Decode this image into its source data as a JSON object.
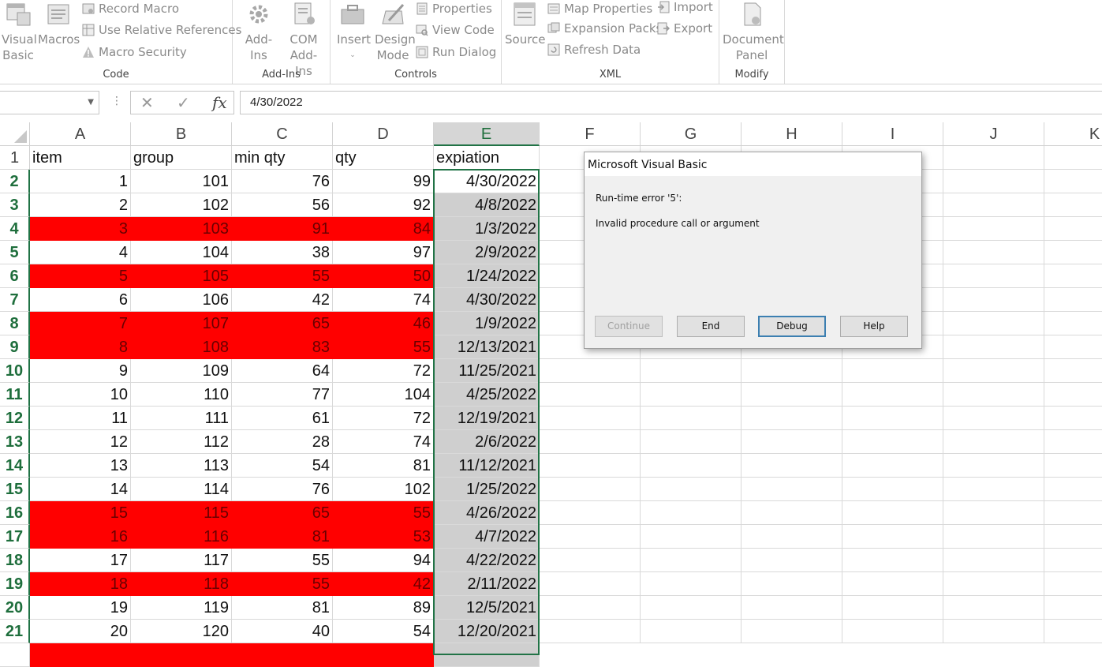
{
  "ribbon": {
    "code": {
      "label": "Code",
      "visual_basic": [
        "Visual",
        "Basic"
      ],
      "macros": "Macros",
      "record_macro": "Record Macro",
      "relative_refs": "Use Relative References",
      "macro_security": "Macro Security"
    },
    "addins": {
      "label": "Add-Ins",
      "addins_btn": "Add-Ins",
      "com_addins": [
        "COM",
        "Add-Ins"
      ]
    },
    "controls": {
      "label": "Controls",
      "insert": "Insert",
      "design_mode": [
        "Design",
        "Mode"
      ],
      "properties": "Properties",
      "view_code": "View Code",
      "run_dialog": "Run Dialog"
    },
    "xml": {
      "label": "XML",
      "source": "Source",
      "map_properties": "Map Properties",
      "expansion_packs": "Expansion Packs",
      "refresh_data": "Refresh Data",
      "import": "Import",
      "export": "Export"
    },
    "modify": {
      "label": "Modify",
      "document_panel": [
        "Document",
        "Panel"
      ]
    }
  },
  "formula_bar": {
    "name_box": "",
    "value": "4/30/2022",
    "fx": "fx"
  },
  "sheet": {
    "columns": [
      "A",
      "B",
      "C",
      "D",
      "E",
      "F",
      "G",
      "H",
      "I",
      "J",
      "K"
    ],
    "selected_column": "E",
    "headers": [
      "item",
      "group",
      "min qty",
      "qty",
      "expiation"
    ],
    "rows": [
      {
        "n": "2",
        "item": "1",
        "group": "101",
        "min": "76",
        "qty": "99",
        "exp": "4/30/2022",
        "red": false
      },
      {
        "n": "3",
        "item": "2",
        "group": "102",
        "min": "56",
        "qty": "92",
        "exp": "4/8/2022",
        "red": false
      },
      {
        "n": "4",
        "item": "3",
        "group": "103",
        "min": "91",
        "qty": "84",
        "exp": "1/3/2022",
        "red": true
      },
      {
        "n": "5",
        "item": "4",
        "group": "104",
        "min": "38",
        "qty": "97",
        "exp": "2/9/2022",
        "red": false
      },
      {
        "n": "6",
        "item": "5",
        "group": "105",
        "min": "55",
        "qty": "50",
        "exp": "1/24/2022",
        "red": true
      },
      {
        "n": "7",
        "item": "6",
        "group": "106",
        "min": "42",
        "qty": "74",
        "exp": "4/30/2022",
        "red": false
      },
      {
        "n": "8",
        "item": "7",
        "group": "107",
        "min": "65",
        "qty": "46",
        "exp": "1/9/2022",
        "red": true
      },
      {
        "n": "9",
        "item": "8",
        "group": "108",
        "min": "83",
        "qty": "55",
        "exp": "12/13/2021",
        "red": true
      },
      {
        "n": "10",
        "item": "9",
        "group": "109",
        "min": "64",
        "qty": "72",
        "exp": "11/25/2021",
        "red": false
      },
      {
        "n": "11",
        "item": "10",
        "group": "110",
        "min": "77",
        "qty": "104",
        "exp": "4/25/2022",
        "red": false
      },
      {
        "n": "12",
        "item": "11",
        "group": "111",
        "min": "61",
        "qty": "72",
        "exp": "12/19/2021",
        "red": false
      },
      {
        "n": "13",
        "item": "12",
        "group": "112",
        "min": "28",
        "qty": "74",
        "exp": "2/6/2022",
        "red": false
      },
      {
        "n": "14",
        "item": "13",
        "group": "113",
        "min": "54",
        "qty": "81",
        "exp": "11/12/2021",
        "red": false
      },
      {
        "n": "15",
        "item": "14",
        "group": "114",
        "min": "76",
        "qty": "102",
        "exp": "1/25/2022",
        "red": false
      },
      {
        "n": "16",
        "item": "15",
        "group": "115",
        "min": "65",
        "qty": "55",
        "exp": "4/26/2022",
        "red": true
      },
      {
        "n": "17",
        "item": "16",
        "group": "116",
        "min": "81",
        "qty": "53",
        "exp": "4/7/2022",
        "red": true
      },
      {
        "n": "18",
        "item": "17",
        "group": "117",
        "min": "55",
        "qty": "94",
        "exp": "4/22/2022",
        "red": false
      },
      {
        "n": "19",
        "item": "18",
        "group": "118",
        "min": "55",
        "qty": "42",
        "exp": "2/11/2022",
        "red": true
      },
      {
        "n": "20",
        "item": "19",
        "group": "119",
        "min": "81",
        "qty": "89",
        "exp": "12/5/2021",
        "red": false
      },
      {
        "n": "21",
        "item": "20",
        "group": "120",
        "min": "40",
        "qty": "54",
        "exp": "12/20/2021",
        "red": false
      }
    ],
    "header_row_number": "1"
  },
  "dialog": {
    "title": "Microsoft Visual Basic",
    "error": "Run-time error '5':",
    "message": "Invalid procedure call or argument",
    "buttons": {
      "continue": "Continue",
      "end": "End",
      "debug": "Debug",
      "help": "Help"
    }
  },
  "colors": {
    "highlight_red": "#ff0000",
    "selection_green": "#217346",
    "selected_gray": "#cfcfcf"
  }
}
